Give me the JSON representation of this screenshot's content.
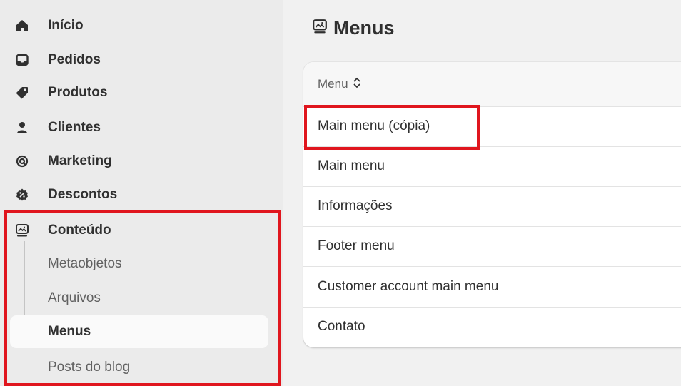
{
  "sidebar": {
    "items": [
      {
        "label": "Início",
        "icon": "home-icon"
      },
      {
        "label": "Pedidos",
        "icon": "inbox-icon"
      },
      {
        "label": "Produtos",
        "icon": "tag-icon"
      },
      {
        "label": "Clientes",
        "icon": "person-icon"
      },
      {
        "label": "Marketing",
        "icon": "target-icon"
      },
      {
        "label": "Descontos",
        "icon": "discount-icon"
      },
      {
        "label": "Conteúdo",
        "icon": "content-icon"
      }
    ],
    "subitems": [
      {
        "label": "Metaobjetos"
      },
      {
        "label": "Arquivos"
      },
      {
        "label": "Menus",
        "active": true
      },
      {
        "label": "Posts do blog"
      }
    ]
  },
  "main": {
    "title": "Menus",
    "title_icon": "content-icon",
    "table": {
      "column_header": "Menu",
      "sort_icon": "sort-icon",
      "rows": [
        "Main menu (cópia)",
        "Main menu",
        "Informações",
        "Footer menu",
        "Customer account main menu",
        "Contato"
      ]
    }
  },
  "colors": {
    "highlight": "#e0161e",
    "sidebar_bg": "#ebebeb",
    "main_bg": "#f1f1f1",
    "card_bg": "#ffffff",
    "text": "#303030",
    "muted_text": "#616161"
  }
}
